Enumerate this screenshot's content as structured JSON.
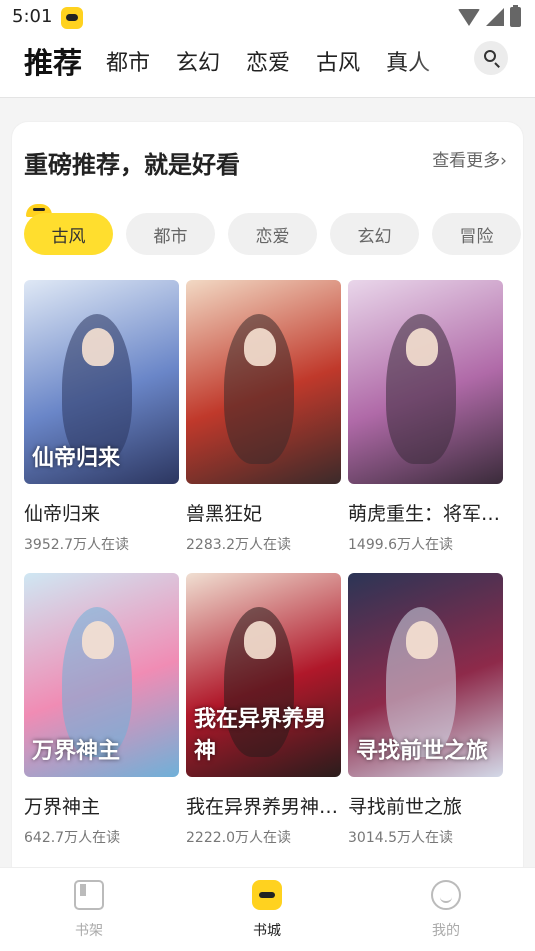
{
  "status_bar": {
    "time": "5:01"
  },
  "nav": {
    "active_tab": "推荐",
    "tabs": [
      "都市",
      "玄幻",
      "恋爱",
      "古风",
      "真人"
    ]
  },
  "section": {
    "title": "重磅推荐，就是好看",
    "see_more": "查看更多›",
    "chips": [
      {
        "label": "古风",
        "active": true
      },
      {
        "label": "都市",
        "active": false
      },
      {
        "label": "恋爱",
        "active": false
      },
      {
        "label": "玄幻",
        "active": false
      },
      {
        "label": "冒险",
        "active": false
      }
    ]
  },
  "books": [
    {
      "title": "仙帝归来",
      "readers": "3952.7万人在读",
      "cover_text": "仙帝归来",
      "colors": [
        "#dfe8f5",
        "#6a86c8",
        "#2c3660"
      ]
    },
    {
      "title": "兽黑狂妃",
      "readers": "2283.2万人在读",
      "cover_text": "",
      "colors": [
        "#f2d9c4",
        "#c0392b",
        "#3b2a2a"
      ]
    },
    {
      "title": "萌虎重生：将军…",
      "readers": "1499.6万人在读",
      "cover_text": "",
      "colors": [
        "#e9d6ea",
        "#b06aa8",
        "#3a2b3a"
      ]
    },
    {
      "title": "万界神主",
      "readers": "642.7万人在读",
      "cover_text": "万界神主",
      "colors": [
        "#cfe7f3",
        "#f08cb4",
        "#6fb0d8"
      ]
    },
    {
      "title": "我在异界养男神…",
      "readers": "2222.0万人在读",
      "cover_text": "我在异界养男神",
      "colors": [
        "#f0dfd2",
        "#b0182a",
        "#2a1c1c"
      ]
    },
    {
      "title": "寻找前世之旅",
      "readers": "3014.5万人在读",
      "cover_text": "寻找前世之旅",
      "colors": [
        "#2b3556",
        "#8e2a4a",
        "#d3d9e8"
      ]
    }
  ],
  "bottom_nav": [
    {
      "label": "书架",
      "icon": "bookshelf-icon",
      "active": false
    },
    {
      "label": "书城",
      "icon": "bookstore-icon",
      "active": true
    },
    {
      "label": "我的",
      "icon": "profile-icon",
      "active": false
    }
  ]
}
